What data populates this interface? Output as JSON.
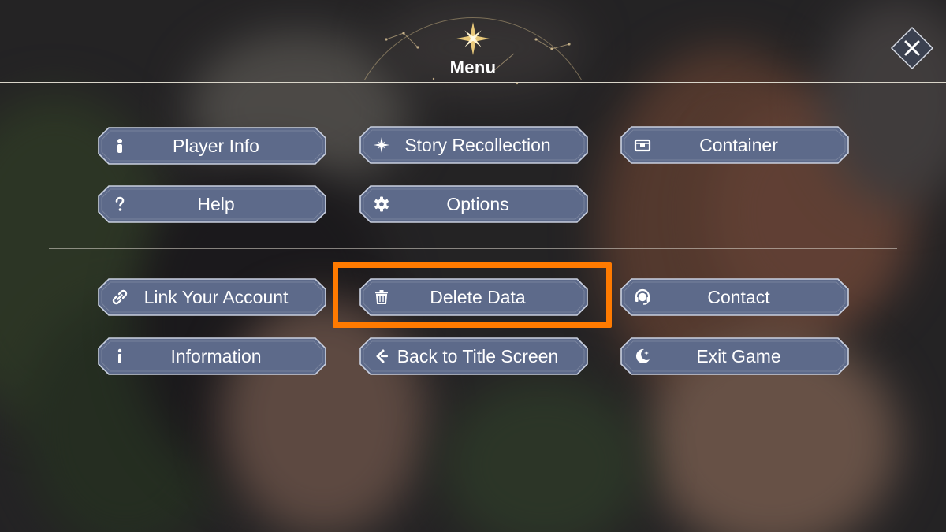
{
  "header": {
    "title": "Menu",
    "close_icon": "close-icon",
    "emblem_icon": "compass-star-icon"
  },
  "colors": {
    "button_fill": "#5d6a8a",
    "button_border": "#c9d0e0",
    "highlight": "#ff7a00",
    "text": "#ffffff",
    "emblem_gold": "#e9c97a"
  },
  "menu": {
    "player_info": {
      "label": "Player Info",
      "icon": "person-icon"
    },
    "story_recollection": {
      "label": "Story Recollection",
      "icon": "sparkle-icon"
    },
    "container": {
      "label": "Container",
      "icon": "box-icon"
    },
    "help": {
      "label": "Help",
      "icon": "question-icon"
    },
    "options": {
      "label": "Options",
      "icon": "gear-icon"
    },
    "link_account": {
      "label": "Link Your Account",
      "icon": "link-icon"
    },
    "delete_data": {
      "label": "Delete Data",
      "icon": "trash-icon"
    },
    "contact": {
      "label": "Contact",
      "icon": "headset-icon"
    },
    "information": {
      "label": "Information",
      "icon": "info-icon"
    },
    "back_to_title": {
      "label": "Back to Title Screen",
      "icon": "back-arrow-icon"
    },
    "exit_game": {
      "label": "Exit Game",
      "icon": "moon-icon"
    }
  }
}
